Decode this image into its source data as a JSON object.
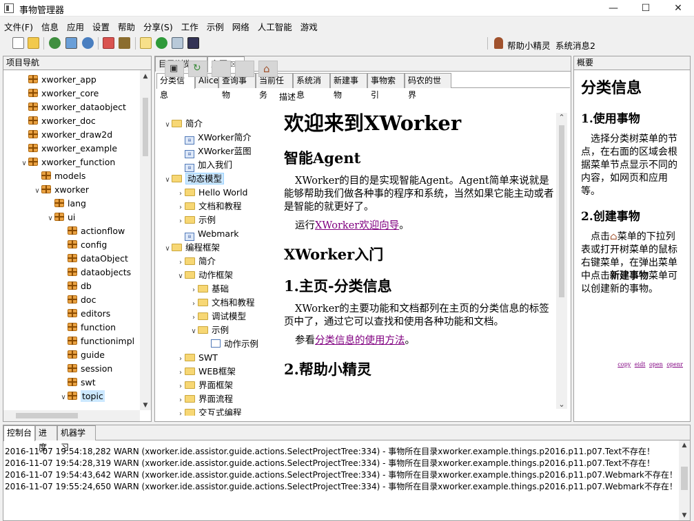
{
  "window": {
    "title": "事物管理器",
    "minimize": "—",
    "maximize": "☐",
    "close": "✕"
  },
  "menu": [
    "文件(F)",
    "信息",
    "应用",
    "设置",
    "帮助",
    "分享(S)",
    "工作",
    "示例",
    "网络",
    "人工智能",
    "游戏"
  ],
  "toolbar": {
    "icons": [
      "new-file-icon",
      "open-folder-icon",
      "refresh-globe-icon",
      "image-globe-icon",
      "globe-gear-icon",
      "pdf-icon",
      "tool-icon",
      "note-icon",
      "web-globe-icon",
      "image-icon",
      "monitor-icon"
    ],
    "assistant_label": "帮助小精灵",
    "system_message": "系统消息2"
  },
  "nav": {
    "title": "项目导航",
    "items": [
      {
        "label": "xworker_app",
        "level": 0,
        "arrow": ""
      },
      {
        "label": "xworker_core",
        "level": 0,
        "arrow": ""
      },
      {
        "label": "xworker_dataobject",
        "level": 0,
        "arrow": ""
      },
      {
        "label": "xworker_doc",
        "level": 0,
        "arrow": ""
      },
      {
        "label": "xworker_draw2d",
        "level": 0,
        "arrow": ""
      },
      {
        "label": "xworker_example",
        "level": 0,
        "arrow": ""
      },
      {
        "label": "xworker_function",
        "level": 0,
        "arrow": "v"
      },
      {
        "label": "models",
        "level": 1,
        "arrow": ""
      },
      {
        "label": "xworker",
        "level": 1,
        "arrow": "v"
      },
      {
        "label": "lang",
        "level": 2,
        "arrow": ""
      },
      {
        "label": "ui",
        "level": 2,
        "arrow": "v"
      },
      {
        "label": "actionflow",
        "level": 3,
        "arrow": ""
      },
      {
        "label": "config",
        "level": 3,
        "arrow": ""
      },
      {
        "label": "dataObject",
        "level": 3,
        "arrow": ""
      },
      {
        "label": "dataobjects",
        "level": 3,
        "arrow": ""
      },
      {
        "label": "db",
        "level": 3,
        "arrow": ""
      },
      {
        "label": "doc",
        "level": 3,
        "arrow": ""
      },
      {
        "label": "editors",
        "level": 3,
        "arrow": ""
      },
      {
        "label": "function",
        "level": 3,
        "arrow": ""
      },
      {
        "label": "functionimpl",
        "level": 3,
        "arrow": ""
      },
      {
        "label": "guide",
        "level": 3,
        "arrow": ""
      },
      {
        "label": "session",
        "level": 3,
        "arrow": ""
      },
      {
        "label": "swt",
        "level": 3,
        "arrow": ""
      },
      {
        "label": "topic",
        "level": 3,
        "arrow": "v",
        "selected": true
      }
    ]
  },
  "middle": {
    "outer_tabs": [
      "目录浏览",
      "主页"
    ],
    "outer_tab_close": "☒",
    "inner_tabs": [
      "分类信息",
      "Alice",
      "查询事物",
      "当前任务",
      "系统消息",
      "新建事物",
      "事物索引",
      "码农的世界"
    ],
    "desc_label": "描述",
    "tree": [
      {
        "label": "简介",
        "level": 0,
        "arrow": "v",
        "icon": "folder"
      },
      {
        "label": "XWorker简介",
        "level": 1,
        "arrow": "",
        "icon": "html"
      },
      {
        "label": "XWorker蓝图",
        "level": 1,
        "arrow": "",
        "icon": "html"
      },
      {
        "label": "加入我们",
        "level": 1,
        "arrow": "",
        "icon": "html"
      },
      {
        "label": "动态模型",
        "level": 0,
        "arrow": "v",
        "icon": "folder",
        "selected": true
      },
      {
        "label": "Hello World",
        "level": 1,
        "arrow": ">",
        "icon": "folder"
      },
      {
        "label": "文档和教程",
        "level": 1,
        "arrow": ">",
        "icon": "folder"
      },
      {
        "label": "示例",
        "level": 1,
        "arrow": ">",
        "icon": "folder"
      },
      {
        "label": "Webmark",
        "level": 1,
        "arrow": "",
        "icon": "html"
      },
      {
        "label": "编程框架",
        "level": 0,
        "arrow": "v",
        "icon": "folder"
      },
      {
        "label": "简介",
        "level": 1,
        "arrow": ">",
        "icon": "folder"
      },
      {
        "label": "动作框架",
        "level": 1,
        "arrow": "v",
        "icon": "folder"
      },
      {
        "label": "基础",
        "level": 2,
        "arrow": ">",
        "icon": "folder"
      },
      {
        "label": "文档和教程",
        "level": 2,
        "arrow": ">",
        "icon": "folder"
      },
      {
        "label": "调试模型",
        "level": 2,
        "arrow": ">",
        "icon": "folder"
      },
      {
        "label": "示例",
        "level": 2,
        "arrow": "v",
        "icon": "folder"
      },
      {
        "label": "动作示例",
        "level": 3,
        "arrow": "",
        "icon": "file"
      },
      {
        "label": "SWT",
        "level": 1,
        "arrow": ">",
        "icon": "folder"
      },
      {
        "label": "WEB框架",
        "level": 1,
        "arrow": ">",
        "icon": "folder"
      },
      {
        "label": "界面框架",
        "level": 1,
        "arrow": ">",
        "icon": "folder"
      },
      {
        "label": "界面流程",
        "level": 1,
        "arrow": ">",
        "icon": "folder"
      },
      {
        "label": "交互式编程",
        "level": 1,
        "arrow": ">",
        "icon": "folder"
      }
    ],
    "content": {
      "title": "欢迎来到XWorker",
      "h_agent": "智能Agent",
      "p_agent": "XWorker的目的是实现智能Agent。Agent简单来说就是能够帮助我们做各种事的程序和系统，当然如果它能主动或者是智能的就更好了。",
      "run_prefix": "运行",
      "run_link": "XWorker欢迎向导",
      "run_suffix": "。",
      "h_intro": "XWorker入门",
      "h_home": "1.主页-分类信息",
      "p_home": "XWorker的主要功能和文档都列在主页的分类信息的标签页中了，通过它可以查找和使用各种功能和文档。",
      "see_prefix": "参看",
      "see_link": "分类信息的使用方法",
      "see_suffix": "。",
      "h_helper": "2.帮助小精灵"
    }
  },
  "right": {
    "title": "概要",
    "heading": "分类信息",
    "h1": "1.使用事物",
    "p1": "选择分类树菜单的节点，在右面的区域会根据菜单节点显示不同的内容，如网页和应用等。",
    "h2": "2.创建事物",
    "p2_a": "点击",
    "p2_b": "菜单的下拉列表或打开树菜单的鼠标右键菜单，在弹出菜单中点击",
    "p2_bold": "新建事物",
    "p2_c": "菜单可以创建新的事物。",
    "links": [
      "copy",
      "eidt",
      "open",
      "openr"
    ]
  },
  "console": {
    "tabs": [
      "控制台",
      "进度",
      "机器学习"
    ],
    "lines": [
      "2016-11-07 19:54:18,282  WARN (xworker.ide.assistor.guide.actions.SelectProjectTree:334) - 事物所在目录xworker.example.things.p2016.p11.p07.Text不存在！",
      "2016-11-07 19:54:28,319  WARN (xworker.ide.assistor.guide.actions.SelectProjectTree:334) - 事物所在目录xworker.example.things.p2016.p11.p07.Text不存在！",
      "2016-11-07 19:54:43,642  WARN (xworker.ide.assistor.guide.actions.SelectProjectTree:334) - 事物所在目录xworker.example.things.p2016.p11.p07.Webmark不存在！",
      "2016-11-07 19:55:24,650  WARN (xworker.ide.assistor.guide.actions.SelectProjectTree:334) - 事物所在目录xworker.example.things.p2016.p11.p07.Webmark不存在！"
    ]
  }
}
